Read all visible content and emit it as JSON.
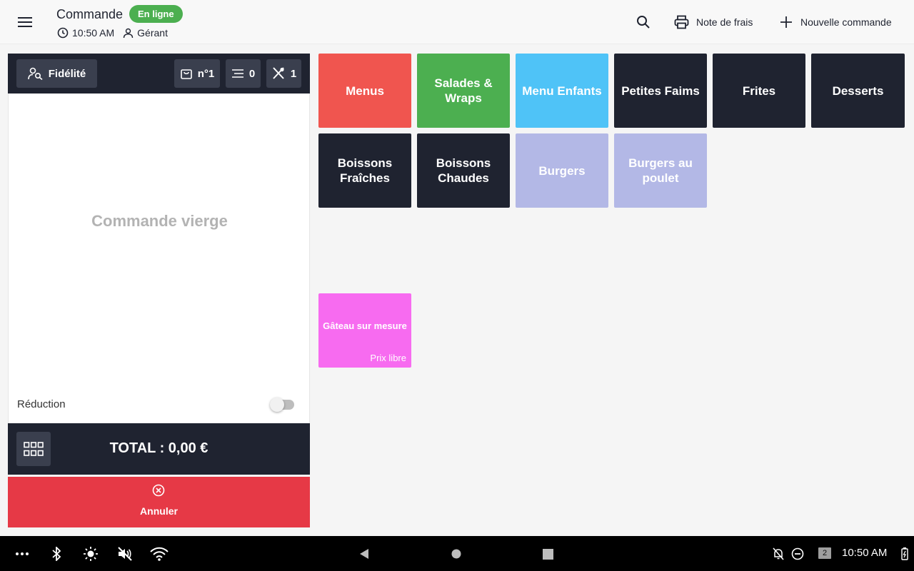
{
  "header": {
    "title": "Commande",
    "status_badge": "En ligne",
    "time": "10:50 AM",
    "user": "Gérant",
    "note_label": "Note de frais",
    "new_order_label": "Nouvelle commande"
  },
  "order_panel": {
    "loyalty_label": "Fidélité",
    "order_number": "n°1",
    "notes_count": "0",
    "covers_count": "1",
    "empty_text": "Commande vierge",
    "reduction_label": "Réduction",
    "reduction_enabled": false,
    "total_label": "TOTAL : 0,00 €",
    "cancel_label": "Annuler"
  },
  "categories": [
    {
      "label": "Menus",
      "color": "#f0554f"
    },
    {
      "label": "Salades & Wraps",
      "color": "#4caf50"
    },
    {
      "label": "Menu Enfants",
      "color": "#4fc3f7"
    },
    {
      "label": "Petites Faims",
      "color": "#1f2330"
    },
    {
      "label": "Frites",
      "color": "#1f2330"
    },
    {
      "label": "Desserts",
      "color": "#1f2330"
    },
    {
      "label": "Boissons Fraîches",
      "color": "#1f2330"
    },
    {
      "label": "Boissons Chaudes",
      "color": "#1f2330"
    },
    {
      "label": "Burgers",
      "color": "#b3b8e6"
    },
    {
      "label": "Burgers au poulet",
      "color": "#b3b8e6"
    }
  ],
  "products": [
    {
      "name": "Gâteau sur mesure",
      "price": "Prix libre",
      "color": "#f76bf0"
    }
  ],
  "system_bar": {
    "time": "10:50 AM",
    "notification_count": "2"
  },
  "colors": {
    "dark": "#1f2330",
    "cancel": "#e63946",
    "online": "#4caf50"
  }
}
